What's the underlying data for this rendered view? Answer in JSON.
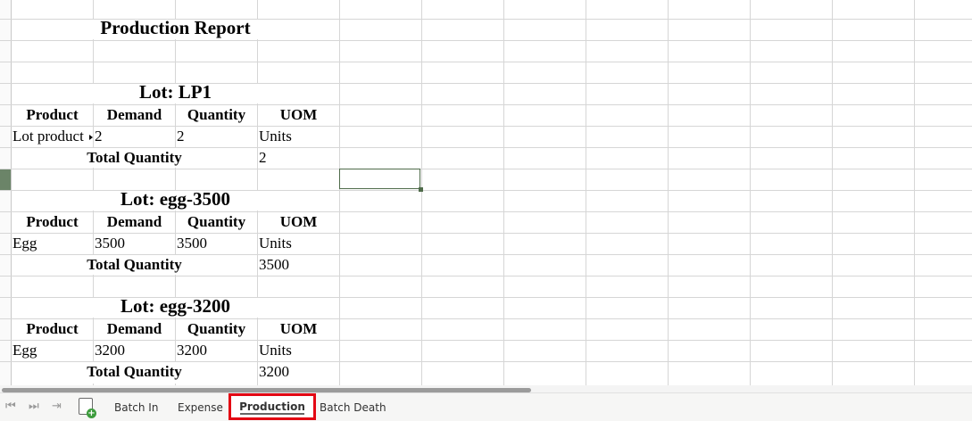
{
  "sheet": {
    "title": "Production Report",
    "lots": [
      {
        "heading": "Lot: LP1",
        "columns": [
          "Product",
          "Demand",
          "Quantity",
          "UOM"
        ],
        "row": [
          "Lot product",
          "2",
          "2",
          "Units"
        ],
        "total_label": "Total Quantity",
        "total_value": "2"
      },
      {
        "heading": "Lot: egg-3500",
        "columns": [
          "Product",
          "Demand",
          "Quantity",
          "UOM"
        ],
        "row": [
          "Egg",
          "3500",
          "3500",
          "Units"
        ],
        "total_label": "Total Quantity",
        "total_value": "3500"
      },
      {
        "heading": "Lot: egg-3200",
        "columns": [
          "Product",
          "Demand",
          "Quantity",
          "UOM"
        ],
        "row": [
          "Egg",
          "3200",
          "3200",
          "Units"
        ],
        "total_label": "Total Quantity",
        "total_value": "3200"
      }
    ]
  },
  "tabs": [
    {
      "label": "Batch In",
      "active": false
    },
    {
      "label": "Expense",
      "active": false
    },
    {
      "label": "Production",
      "active": true
    },
    {
      "label": "Batch Death",
      "active": false
    }
  ],
  "nav": {
    "first_icon": "first-sheet-icon",
    "prev_icon": "prev-sheet-icon",
    "last_icon": "last-sheet-icon",
    "add_icon": "add-sheet-icon"
  },
  "colors": {
    "grid": "#d6d6d6",
    "selection": "#4f6b4a",
    "active_tab_highlight": "#e30613"
  }
}
